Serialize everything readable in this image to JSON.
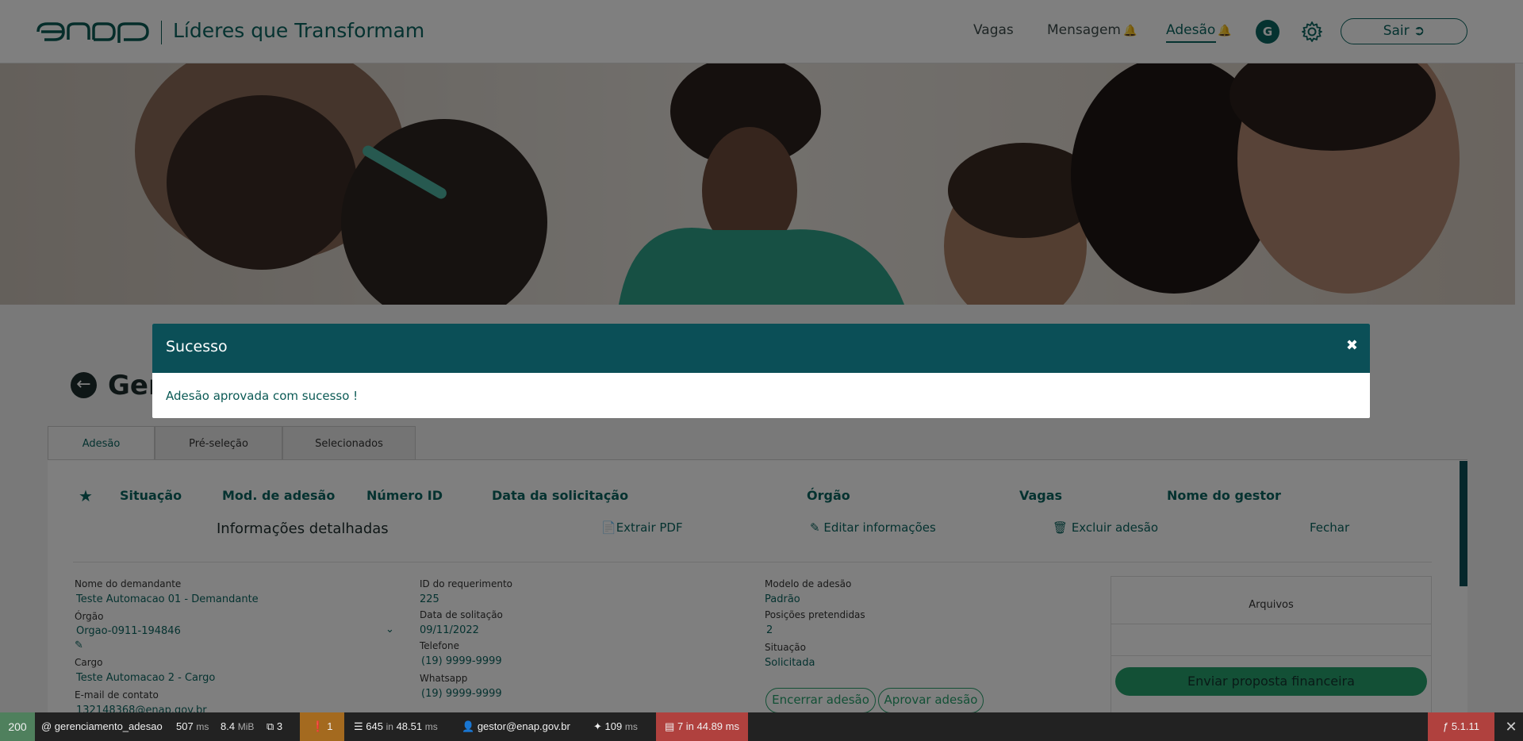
{
  "header": {
    "site_title": "Líderes que Transformam",
    "nav": [
      {
        "label": "Vagas",
        "has_bell": false,
        "active": false
      },
      {
        "label": "Mensagem",
        "has_bell": true,
        "active": false
      },
      {
        "label": "Adesão",
        "has_bell": true,
        "active": true
      }
    ],
    "avatar_letter": "G",
    "logout_label": "Sair"
  },
  "page": {
    "title": "Gerenciamento",
    "tabs": [
      "Adesão",
      "Pré-seleção",
      "Selecionados"
    ],
    "columns": [
      "Situação",
      "Mod. de adesão",
      "Número ID",
      "Data da solicitação",
      "Órgão",
      "Vagas",
      "Nome do gestor"
    ],
    "detail_title": "Informações detalhadas",
    "actions": {
      "extract_pdf": "Extrair PDF",
      "edit_info": "Editar informações",
      "delete": "Excluir adesão",
      "close": "Fechar"
    },
    "fields": {
      "demandante_label": "Nome do demandante",
      "demandante_value": "Teste Automacao 01 - Demandante",
      "orgao_label": "Órgão",
      "orgao_value": "Orgao-0911-194846",
      "cargo_label": "Cargo",
      "cargo_value": "Teste Automacao 2 - Cargo",
      "email_label": "E-mail de contato",
      "email_value": "132148368@enap.gov.br",
      "req_id_label": "ID do requerimento",
      "req_id_value": "225",
      "date_label": "Data de solitação",
      "date_value": "09/11/2022",
      "phone_label": "Telefone",
      "phone_value": "(19) 9999-9999",
      "whatsapp_label": "Whatsapp",
      "whatsapp_value": "(19) 9999-9999",
      "model_label": "Modelo de adesão",
      "model_value": "Padrão",
      "positions_label": "Posições pretendidas",
      "positions_value": "2",
      "status_label": "Situação",
      "status_value": "Solicitada"
    },
    "files_title": "Arquivos",
    "send_proposal": "Enviar proposta financeira",
    "end_adhesion": "Encerrar adesão",
    "approve_adhesion": "Aprovar adesão"
  },
  "modal": {
    "title": "Sucesso",
    "close_symbol": "✖",
    "message": "Adesão aprovada com sucesso !"
  },
  "debug_toolbar": {
    "status": "200",
    "route": "@ gerenciamento_adesao",
    "time_value": "507",
    "time_unit": "ms",
    "mem_value": "8.4",
    "mem_unit": "MiB",
    "forms": "3",
    "warnings": "1",
    "queries_count": "645",
    "queries_in": "in",
    "queries_time": "48.51",
    "queries_unit": "ms",
    "user": "gestor@enap.gov.br",
    "twig_time": "109",
    "twig_unit": "ms",
    "cache": "7 in 44.89 ms",
    "version": "5.1.11"
  },
  "colors": {
    "brand": "#0b6560",
    "modal_header": "#0b4f57",
    "green_button": "#27a06c"
  }
}
